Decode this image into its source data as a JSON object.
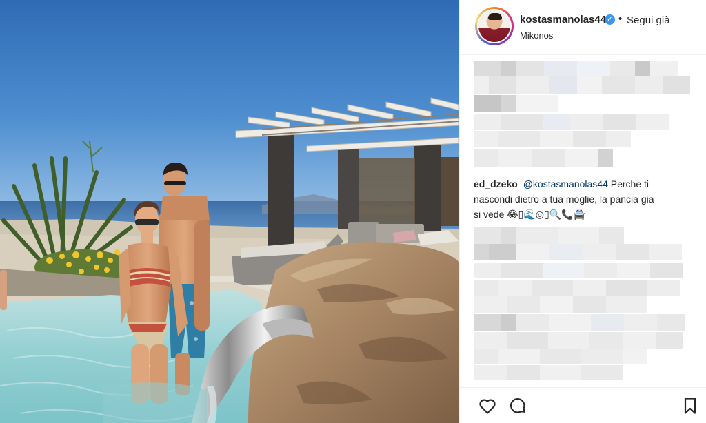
{
  "post": {
    "username": "kostasmanolas44",
    "verified_icon": "verified-badge-icon",
    "separator": "•",
    "follow_status": "Segui già",
    "location": "Mikonos"
  },
  "comment": {
    "user": "ed_dzeko",
    "mention": "@kostasmanolas44",
    "text_line1": "Perche ti",
    "text_line2": "nascondi dietro a tua moglie, la pancia gia",
    "text_line3": "si vede",
    "emojis": "😂▯🌊◎▯🔍📞🚔"
  },
  "actions": {
    "like_icon": "heart-icon",
    "comment_icon": "comment-icon",
    "save_icon": "bookmark-icon"
  },
  "colors": {
    "verified": "#3897f0",
    "text": "#262626",
    "mention": "#00376b",
    "border": "#efefef"
  }
}
